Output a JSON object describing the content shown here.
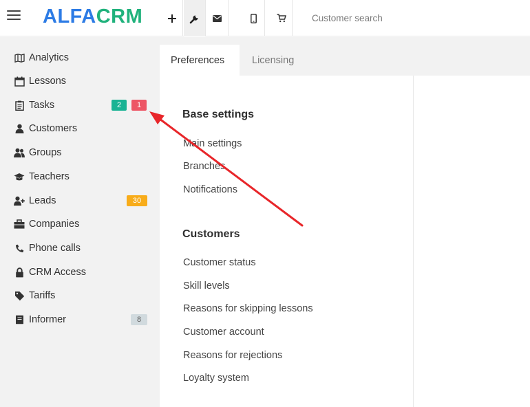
{
  "app": {
    "logo_part1": "ALFA",
    "logo_part2": "CRM",
    "colors": {
      "brand_blue": "#2c7be5",
      "brand_green": "#20b27c",
      "annotation_arrow": "#e8262a"
    }
  },
  "toolbar": {
    "icons": [
      "menu-icon",
      "plus-icon",
      "wrench-icon",
      "envelope-icon",
      "mobile-phone-icon",
      "cart-icon"
    ],
    "search_placeholder": "Customer search"
  },
  "sidebar": {
    "items": [
      {
        "label": "Analytics",
        "icon": "map-icon"
      },
      {
        "label": "Lessons",
        "icon": "calendar-icon"
      },
      {
        "label": "Tasks",
        "icon": "clipboard-icon",
        "badges": [
          "2",
          "1"
        ]
      },
      {
        "label": "Customers",
        "icon": "user-icon"
      },
      {
        "label": "Groups",
        "icon": "users-icon"
      },
      {
        "label": "Teachers",
        "icon": "graduation-cap-icon"
      },
      {
        "label": "Leads",
        "icon": "user-plus-icon",
        "badges": [
          "30"
        ]
      },
      {
        "label": "Companies",
        "icon": "briefcase-icon"
      },
      {
        "label": "Phone calls",
        "icon": "phone-icon"
      },
      {
        "label": "CRM Access",
        "icon": "lock-icon"
      },
      {
        "label": "Tariffs",
        "icon": "tag-icon"
      },
      {
        "label": "Informer",
        "icon": "book-icon",
        "badges": [
          "8"
        ]
      }
    ]
  },
  "tabs": [
    {
      "label": "Preferences",
      "active": true
    },
    {
      "label": "Licensing",
      "active": false
    }
  ],
  "settings": {
    "sections": [
      {
        "title": "Base settings",
        "links": [
          "Main settings",
          "Branches",
          "Notifications"
        ]
      },
      {
        "title": "Customers",
        "links": [
          "Customer status",
          "Skill levels",
          "Reasons for skipping lessons",
          "Customer account",
          "Reasons for rejections",
          "Loyalty system"
        ]
      }
    ]
  }
}
